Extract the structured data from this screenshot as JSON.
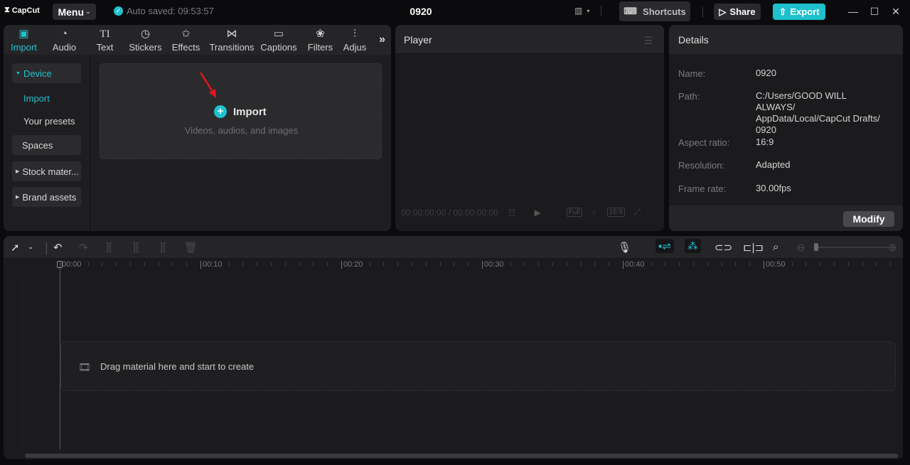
{
  "titlebar": {
    "app_name": "CapCut",
    "menu_label": "Menu",
    "autosave_text": "Auto saved: 09:53:57",
    "project_title": "0920",
    "shortcuts_label": "Shortcuts",
    "share_label": "Share",
    "export_label": "Export",
    "accent_color": "#1fc3d0"
  },
  "media_tabs": [
    {
      "label": "Import",
      "icon": "import-icon",
      "active": true
    },
    {
      "label": "Audio",
      "icon": "audio-icon"
    },
    {
      "label": "Text",
      "icon": "text-icon"
    },
    {
      "label": "Stickers",
      "icon": "sticker-icon"
    },
    {
      "label": "Effects",
      "icon": "effects-icon"
    },
    {
      "label": "Transitions",
      "icon": "transitions-icon"
    },
    {
      "label": "Captions",
      "icon": "captions-icon"
    },
    {
      "label": "Filters",
      "icon": "filters-icon"
    },
    {
      "label": "Adjus",
      "icon": "adjust-icon"
    }
  ],
  "sidebar": {
    "device": "Device",
    "import": "Import",
    "presets": "Your presets",
    "spaces": "Spaces",
    "stock": "Stock mater...",
    "brand": "Brand assets"
  },
  "import_area": {
    "title": "Import",
    "subtitle": "Videos, audios, and images"
  },
  "player": {
    "title": "Player",
    "timecode": "00:00:00:00 / 00:00:00:00",
    "full_label": "Full",
    "ratio_label": "16:9"
  },
  "details": {
    "title": "Details",
    "rows": [
      {
        "label": "Name:",
        "value": "0920"
      },
      {
        "label": "Path:",
        "value": "C:/Users/GOOD WILL ALWAYS/ AppData/Local/CapCut Drafts/ 0920"
      },
      {
        "label": "Aspect ratio:",
        "value": "16:9"
      },
      {
        "label": "Resolution:",
        "value": "Adapted"
      },
      {
        "label": "Frame rate:",
        "value": "30.00fps"
      }
    ],
    "modify_label": "Modify"
  },
  "timeline": {
    "ruler_labels": [
      "00:00",
      "00:10",
      "00:20",
      "00:30",
      "00:40",
      "00:50"
    ],
    "drop_text": "Drag material here and start to create"
  }
}
